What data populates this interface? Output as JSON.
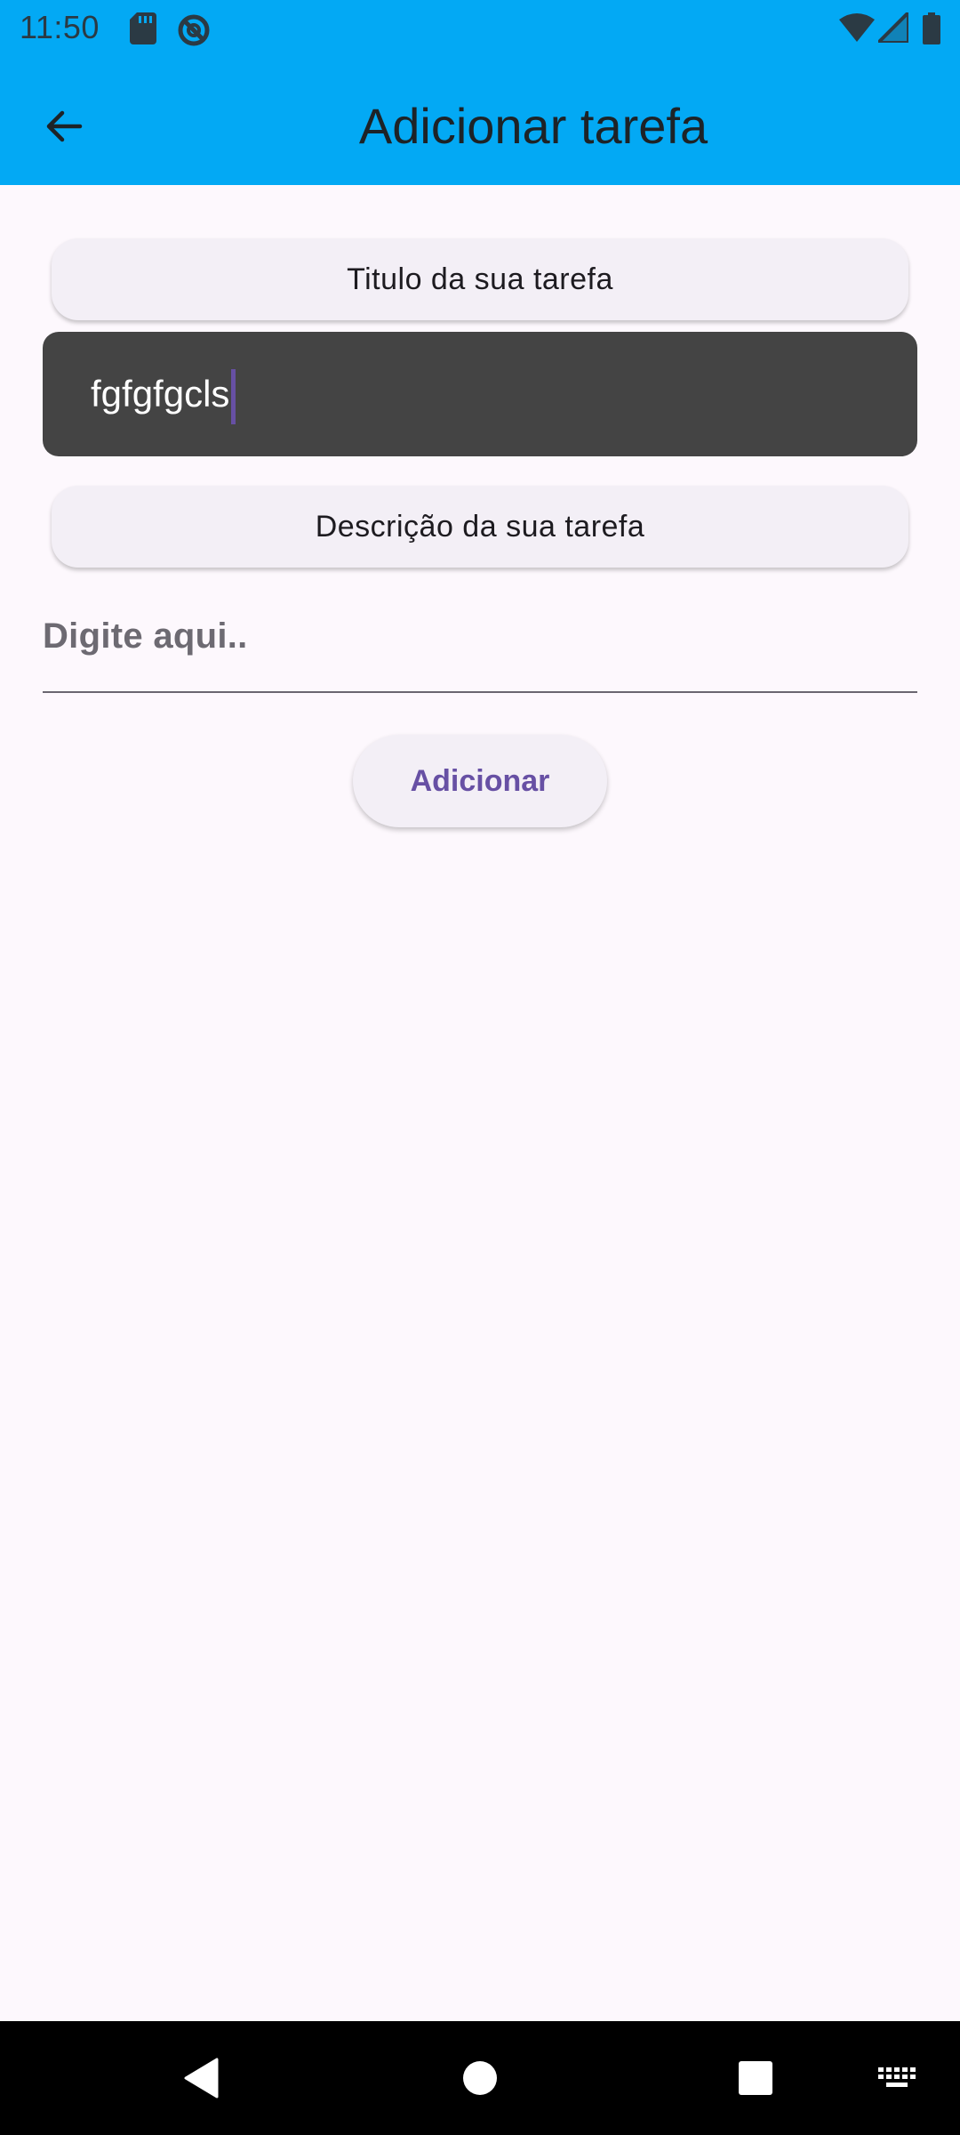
{
  "status_bar": {
    "time": "11:50",
    "icons": [
      "sd-card-icon",
      "data-saver-icon",
      "wifi-icon",
      "signal-icon",
      "battery-icon"
    ]
  },
  "app_bar": {
    "back_icon": "arrow-left-icon",
    "title": "Adicionar tarefa"
  },
  "form": {
    "title_label": "Titulo da sua tarefa",
    "title_value": "fgfgfgcls",
    "description_label": "Descrição da sua tarefa",
    "description_placeholder": "Digite aqui..",
    "description_value": "",
    "submit_label": "Adicionar"
  },
  "nav_bar": {
    "icons": [
      "back-triangle-icon",
      "home-circle-icon",
      "recents-square-icon",
      "keyboard-icon"
    ]
  },
  "colors": {
    "app_bar": "#03a9f4",
    "background": "#fdf8fd",
    "text_field_fill": "#444444",
    "accent": "#6750a4"
  }
}
